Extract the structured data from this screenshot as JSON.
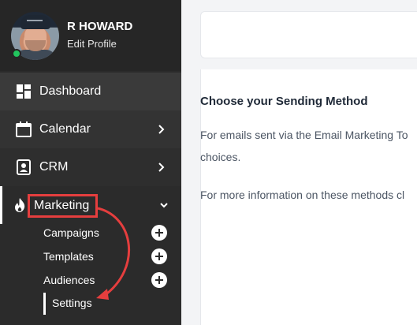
{
  "profile": {
    "name": "R HOWARD",
    "edit_link": "Edit Profile"
  },
  "nav": {
    "dashboard": "Dashboard",
    "calendar": "Calendar",
    "crm": "CRM",
    "marketing": "Marketing"
  },
  "marketing_sub": {
    "campaigns": "Campaigns",
    "templates": "Templates",
    "audiences": "Audiences",
    "settings": "Settings"
  },
  "content": {
    "heading": "Choose your Sending Method",
    "para1_line1": "For emails sent via the Email Marketing To",
    "para1_line2": "choices.",
    "para2": "For more information on these methods cl"
  },
  "colors": {
    "sidebar_bg": "#2b2b2b",
    "highlight_red": "#e53e3e",
    "status_green": "#22c55e"
  }
}
